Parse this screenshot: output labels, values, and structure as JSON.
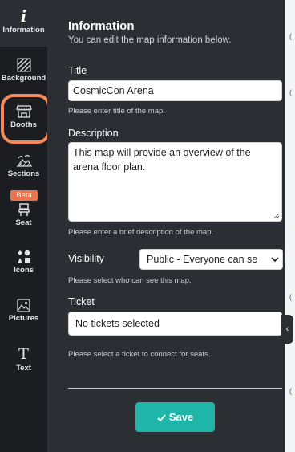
{
  "sidebar": {
    "items": [
      {
        "label": "Information",
        "icon": "info-icon"
      },
      {
        "label": "Background",
        "icon": "background-pattern-icon"
      },
      {
        "label": "Booths",
        "icon": "booth-stall-icon"
      },
      {
        "label": "Sections",
        "icon": "sections-landscape-icon"
      },
      {
        "label": "Seat",
        "icon": "seat-icon",
        "badge": "Beta"
      },
      {
        "label": "Icons",
        "icon": "shapes-icon"
      },
      {
        "label": "Pictures",
        "icon": "picture-icon"
      },
      {
        "label": "Text",
        "icon": "text-icon"
      }
    ],
    "highlighted": "Booths",
    "highlight_color": "#f08a5d"
  },
  "panel": {
    "title": "Information",
    "subtitle": "You can edit the map information below.",
    "title_field": {
      "label": "Title",
      "value": "CosmicCon Arena",
      "hint": "Please enter title of the map."
    },
    "description_field": {
      "label": "Description",
      "value": "This map will provide an overview of the arena floor plan.",
      "hint": "Please enter a brief description of the map."
    },
    "visibility_field": {
      "label": "Visibility",
      "value": "Public - Everyone can se",
      "hint": "Please select who can see this map."
    },
    "ticket_field": {
      "label": "Ticket",
      "value": "No tickets selected",
      "hint": "Please select a ticket to connect for seats."
    },
    "save_label": "Save",
    "save_color": "#1fb5a9"
  },
  "canvas_strip": {
    "marks": [
      "(",
      "(",
      "(",
      "("
    ],
    "collapse_label": "‹"
  }
}
